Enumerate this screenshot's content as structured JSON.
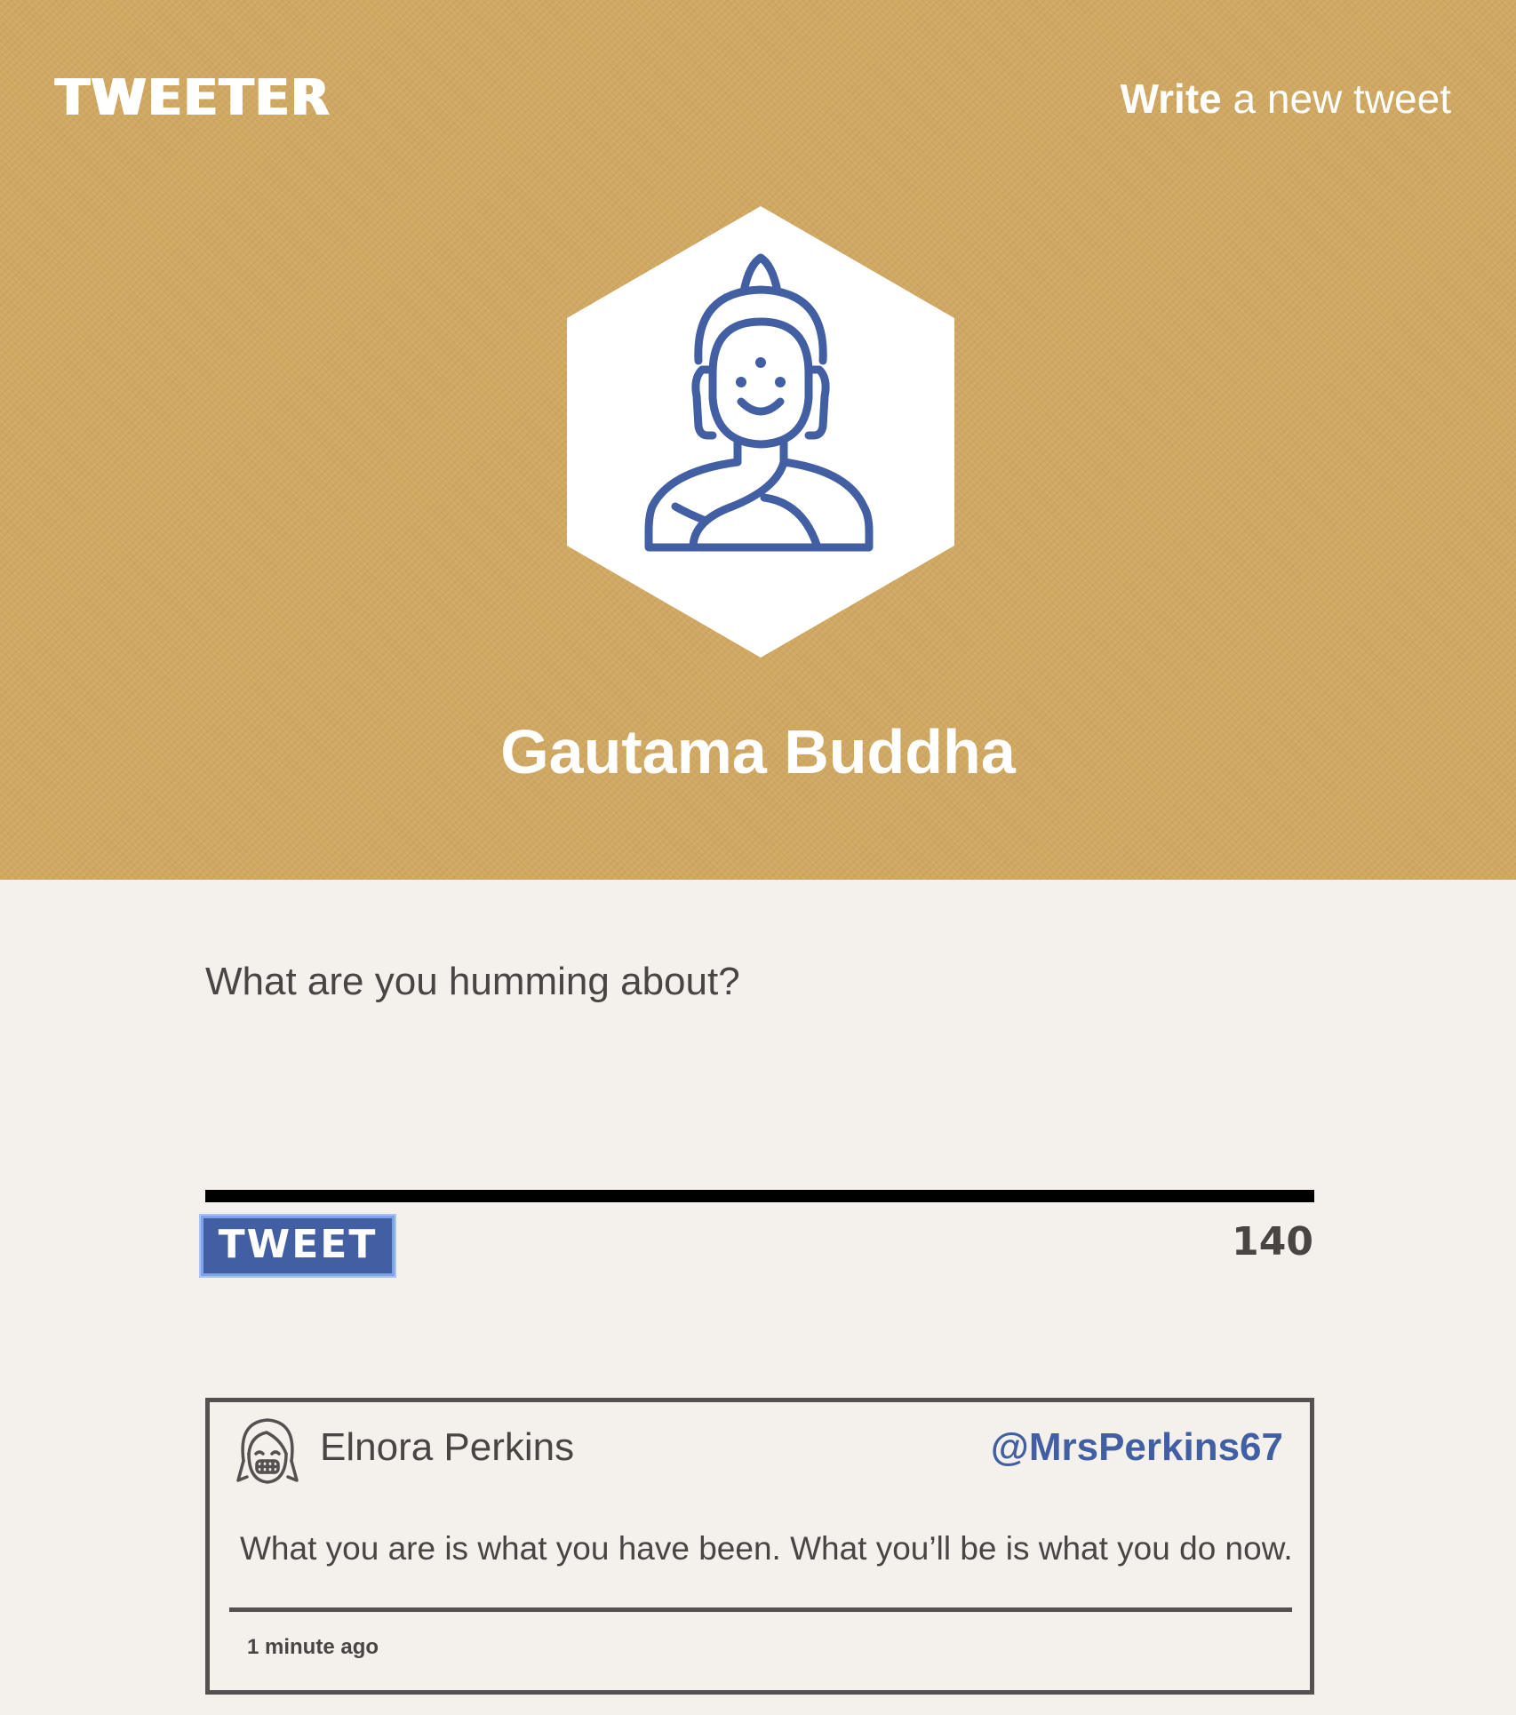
{
  "header": {
    "brand": "TWEETER",
    "compose_bold": "Write",
    "compose_rest": " a new tweet"
  },
  "profile": {
    "name": "Gautama Buddha",
    "avatar_icon": "buddha-icon",
    "icon_color": "#425fa3"
  },
  "composer": {
    "placeholder": "What are you humming about?",
    "value": "",
    "submit_label": "TWEET",
    "char_counter": "140"
  },
  "tweets": [
    {
      "author": "Elnora Perkins",
      "handle": "@MrsPerkins67",
      "avatar_icon": "girl-avatar-icon",
      "text": "What you are is what you have been. What you’ll be is what you do now.",
      "time": "1 minute ago"
    }
  ],
  "colors": {
    "hero_background": "#d0a861",
    "page_background": "#f4f1ec",
    "accent": "#425fa3"
  }
}
